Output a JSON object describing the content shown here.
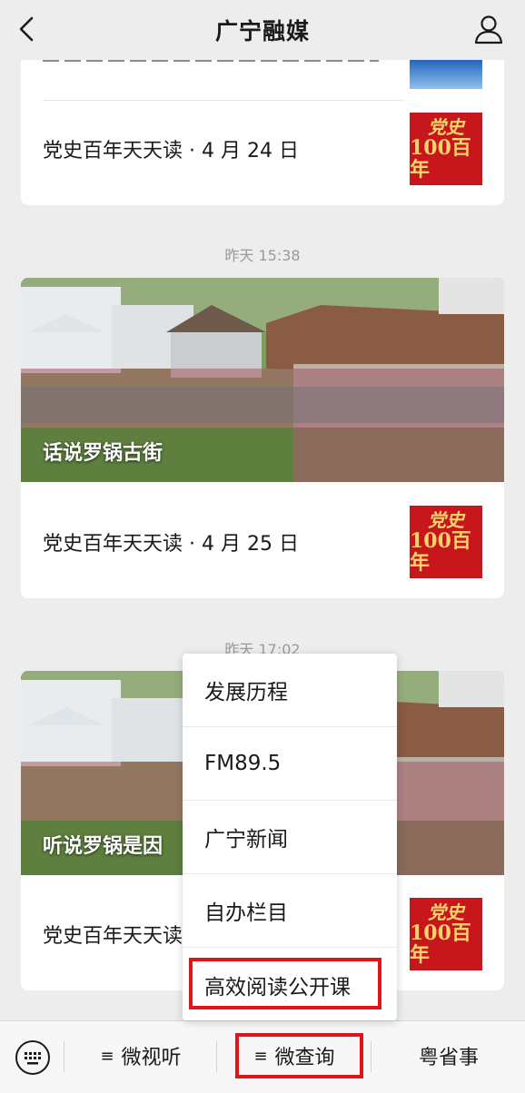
{
  "header": {
    "title": "广宁融媒",
    "back_icon": "chevron-left-icon",
    "user_icon": "user-icon"
  },
  "messages": [
    {
      "row_text": "党史百年天天读 · 4 月 24 日",
      "thumb_line1": "党史",
      "thumb_line2": "100百年"
    },
    {
      "timestamp": "昨天 15:38",
      "hero_title": "话说罗锅古街",
      "row_text": "党史百年天天读 · 4 月 25 日",
      "thumb_line1": "党史",
      "thumb_line2": "100百年"
    },
    {
      "timestamp": "昨天 17:02",
      "hero_title": "听说罗锅是因",
      "row_text": "党史百年天天读",
      "thumb_line1": "党史",
      "thumb_line2": "100百年"
    }
  ],
  "popup_menu": {
    "items": [
      "发展历程",
      "FM89.5",
      "广宁新闻",
      "自办栏目",
      "高效阅读公开课"
    ],
    "highlighted_item": "高效阅读公开课"
  },
  "bottom_bar": {
    "keyboard_icon": "keyboard-icon",
    "tabs": [
      {
        "label": "微视听",
        "icon": "menu-icon"
      },
      {
        "label": "微查询",
        "icon": "menu-icon"
      },
      {
        "label": "粤省事"
      }
    ],
    "hamburger_glyph": "≡"
  },
  "colors": {
    "highlight": "#e0141b",
    "background": "#ededed",
    "thumb_red": "#c8161d"
  }
}
